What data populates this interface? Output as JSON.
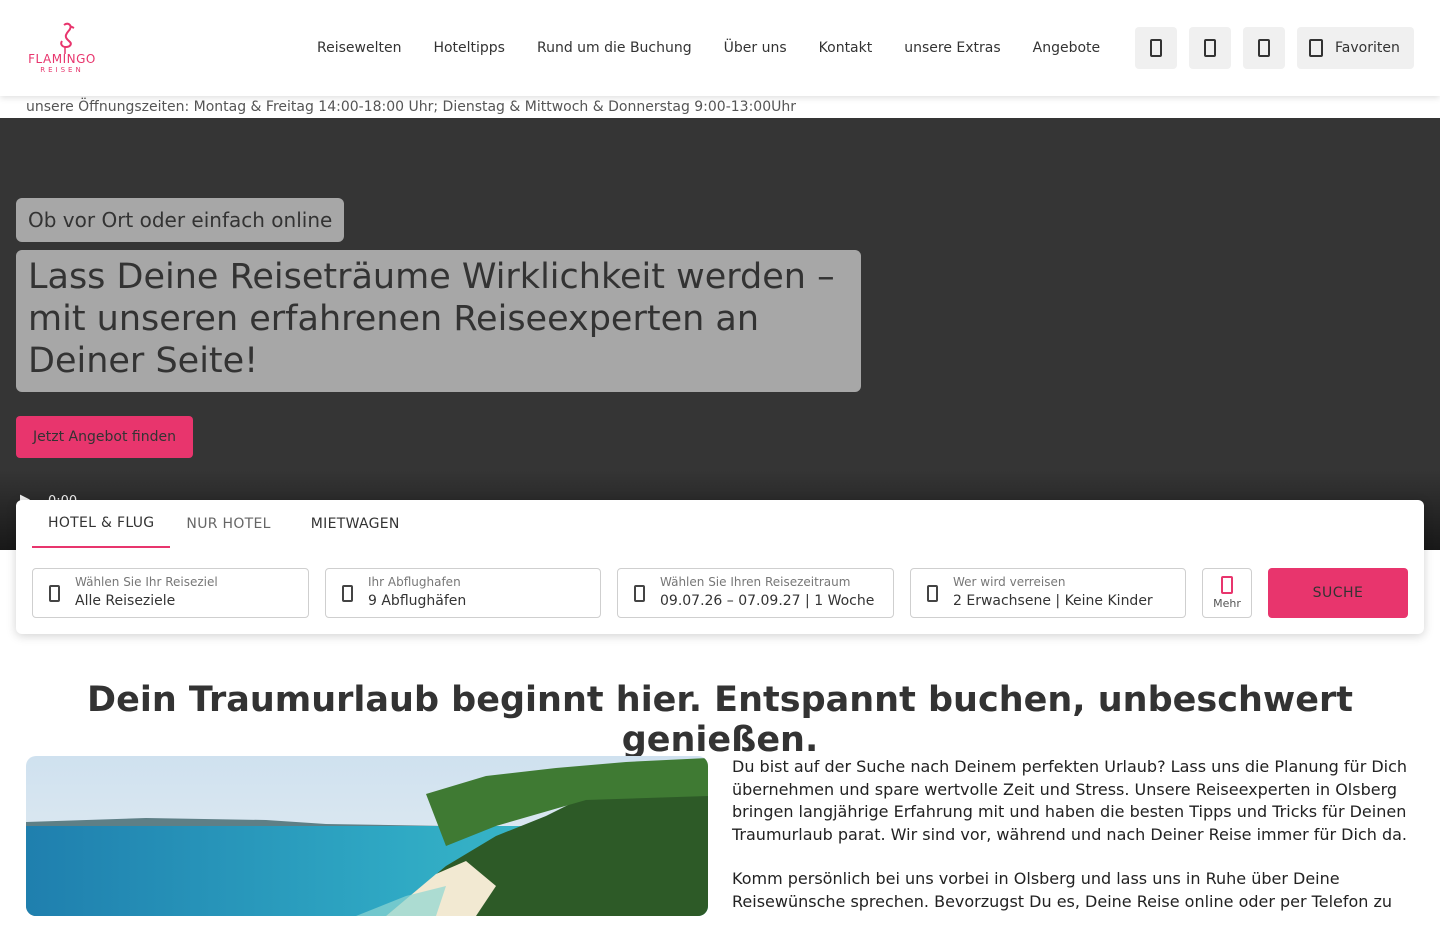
{
  "brand": {
    "logo_text": "FLAMINGO",
    "logo_subtext": "REISEN",
    "accent_color": "#e8356d"
  },
  "nav": {
    "items": [
      "Reisewelten",
      "Hoteltipps",
      "Rund um die Buchung",
      "Über uns",
      "Kontakt",
      "unsere Extras",
      "Angebote"
    ],
    "favorites_label": "Favoriten",
    "icon_buttons": [
      "phone-icon",
      "mail-icon",
      "user-icon"
    ]
  },
  "hours_text": "unsere Öffnungszeiten: Montag & Freitag 14:00-18:00 Uhr; Dienstag & Mittwoch & Donnerstag 9:00-13:00Uhr",
  "hero": {
    "eyebrow": "Ob vor Ort oder einfach online",
    "headline": "Lass Deine Reiseträume Wirklichkeit werden – mit unseren erfahrenen Reiseexperten an Deiner Seite!",
    "cta_label": "Jetzt Angebot finden",
    "video_time": "0:00"
  },
  "search": {
    "tabs": [
      "HOTEL & FLUG",
      "NUR HOTEL",
      "MIETWAGEN"
    ],
    "active_tab": "HOTEL & FLUG",
    "fields": [
      {
        "label": "Wählen Sie Ihr Reiseziel",
        "value": "Alle Reiseziele"
      },
      {
        "label": "Ihr Abflughafen",
        "value": "9 Abflughäfen"
      },
      {
        "label": "Wählen Sie Ihren Reisezeitraum",
        "value": "09.07.26 – 07.09.27 | 1 Woche"
      },
      {
        "label": "Wer wird verreisen",
        "value": "2 Erwachsene | Keine Kinder"
      }
    ],
    "more_label": "Mehr",
    "submit_label": "SUCHE"
  },
  "content": {
    "title": "Dein Traumurlaub beginnt hier. Entspannt buchen, unbeschwert genießen.",
    "paragraphs": [
      "Du bist auf der Suche nach Deinem perfekten Urlaub? Lass uns die Planung für Dich übernehmen und spare wertvolle Zeit und Stress. Unsere Reiseexperten in Olsberg bringen langjährige Erfahrung mit und haben die besten Tipps und Tricks für Deinen Traumurlaub parat. Wir sind vor, während und nach Deiner Reise immer für Dich da.",
      "Komm persönlich bei uns vorbei in Olsberg und lass uns in Ruhe über Deine Reisewünsche sprechen. Bevorzugst Du es, Deine Reise online oder per Telefon zu"
    ]
  }
}
